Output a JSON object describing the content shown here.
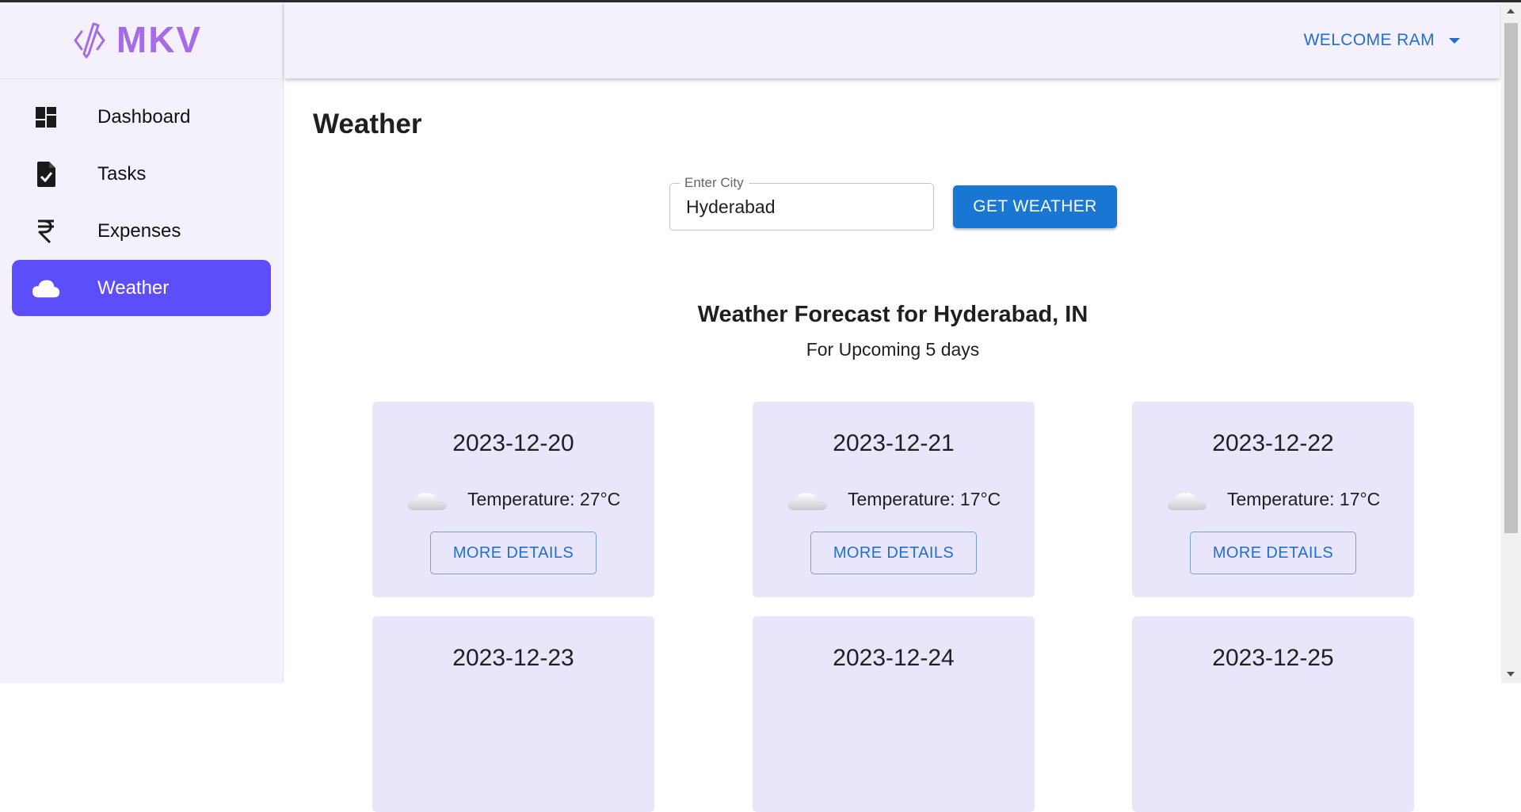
{
  "app": {
    "logo_text": "MKV"
  },
  "colors": {
    "accent": "#5c4efb",
    "primary": "#1976d2",
    "sidebar_bg": "#f4f1fd",
    "card_bg": "#e9e6fb"
  },
  "sidebar": {
    "items": [
      {
        "label": "Dashboard",
        "icon": "dashboard-icon",
        "active": false
      },
      {
        "label": "Tasks",
        "icon": "task-file-icon",
        "active": false
      },
      {
        "label": "Expenses",
        "icon": "rupee-icon",
        "active": false
      },
      {
        "label": "Weather",
        "icon": "cloud-icon",
        "active": true
      }
    ]
  },
  "header": {
    "welcome": "WELCOME RAM"
  },
  "page": {
    "title": "Weather"
  },
  "search": {
    "label": "Enter City",
    "value": "Hyderabad",
    "button": "GET WEATHER"
  },
  "forecast": {
    "title": "Weather Forecast for Hyderabad, IN",
    "subtitle": "For Upcoming 5 days",
    "more_label": "MORE DETAILS",
    "days": [
      {
        "date": "2023-12-20",
        "temperature": "Temperature: 27°C",
        "icon": "cloud-icon"
      },
      {
        "date": "2023-12-21",
        "temperature": "Temperature: 17°C",
        "icon": "cloud-icon"
      },
      {
        "date": "2023-12-22",
        "temperature": "Temperature: 17°C",
        "icon": "cloud-icon"
      },
      {
        "date": "2023-12-23"
      },
      {
        "date": "2023-12-24"
      },
      {
        "date": "2023-12-25"
      }
    ]
  }
}
